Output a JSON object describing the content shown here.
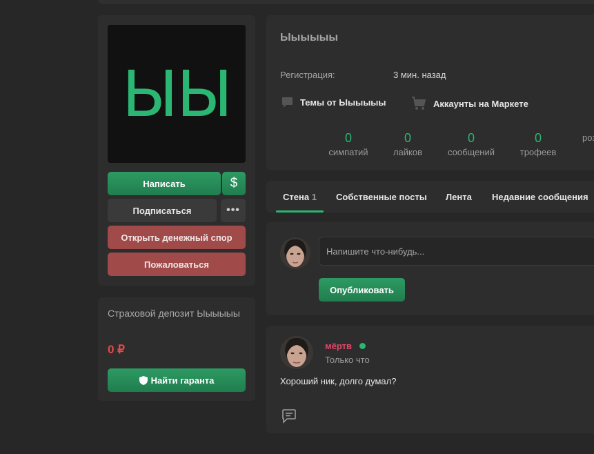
{
  "profile": {
    "avatar_text": "ЫЫ",
    "username": "Ыыыыыы",
    "registration_label": "Регистрация:",
    "registration_value": "3 мин. назад"
  },
  "actions": {
    "write": "Написать",
    "dollar": "$",
    "subscribe": "Подписаться",
    "more": "•••",
    "dispute": "Открыть денежный спор",
    "report": "Пожаловаться"
  },
  "deposit": {
    "title": "Страховой депозит Ыыыыыы",
    "amount": "0 ₽",
    "guarantor_button": "Найти гаранта"
  },
  "links": {
    "topics": "Темы от Ыыыыыы",
    "market": "Аккаунты на Маркете"
  },
  "stats": [
    {
      "value": "0",
      "label": "симпатий"
    },
    {
      "value": "0",
      "label": "лайков"
    },
    {
      "value": "0",
      "label": "сообщений"
    },
    {
      "value": "0",
      "label": "трофеев"
    },
    {
      "value": "",
      "label": "роз"
    }
  ],
  "tabs": [
    {
      "label": "Стена",
      "count": "1"
    },
    {
      "label": "Собственные посты"
    },
    {
      "label": "Лента"
    },
    {
      "label": "Недавние сообщения"
    }
  ],
  "composer": {
    "placeholder": "Напишите что-нибудь...",
    "publish": "Опубликовать"
  },
  "post": {
    "author": "мёртв",
    "time": "Только что",
    "text": "Хороший ник, долго думал?"
  },
  "colors": {
    "accent": "#2bb673",
    "danger": "#e5484d",
    "author": "#e5486b",
    "report_button": "#a04a4a"
  }
}
